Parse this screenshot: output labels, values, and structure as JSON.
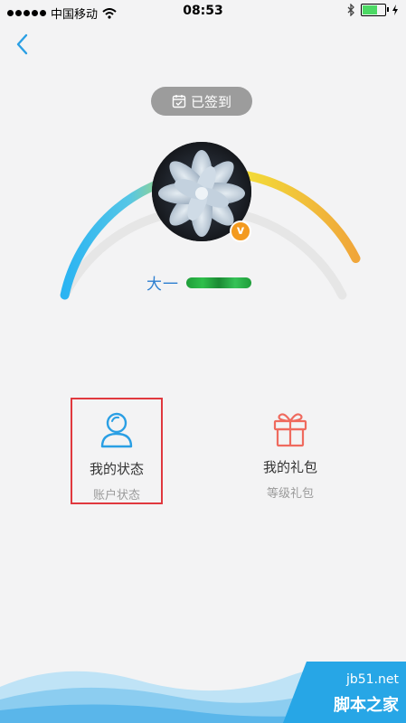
{
  "status_bar": {
    "carrier": "中国移动",
    "time": "08:53"
  },
  "header": {
    "signed_label": "已签到"
  },
  "profile": {
    "level": "大一"
  },
  "actions": [
    {
      "title": "我的状态",
      "subtitle": "账户状态",
      "icon": "person-icon",
      "color": "#2a9fe4"
    },
    {
      "title": "我的礼包",
      "subtitle": "等级礼包",
      "icon": "gift-icon",
      "color": "#ef6a5e"
    }
  ],
  "watermark": {
    "url": "jb51.net",
    "name": "脚本之家"
  },
  "colors": {
    "accent_blue": "#2d7fd0",
    "badge_orange": "#f39a1f",
    "highlight_red": "#e0383e"
  }
}
